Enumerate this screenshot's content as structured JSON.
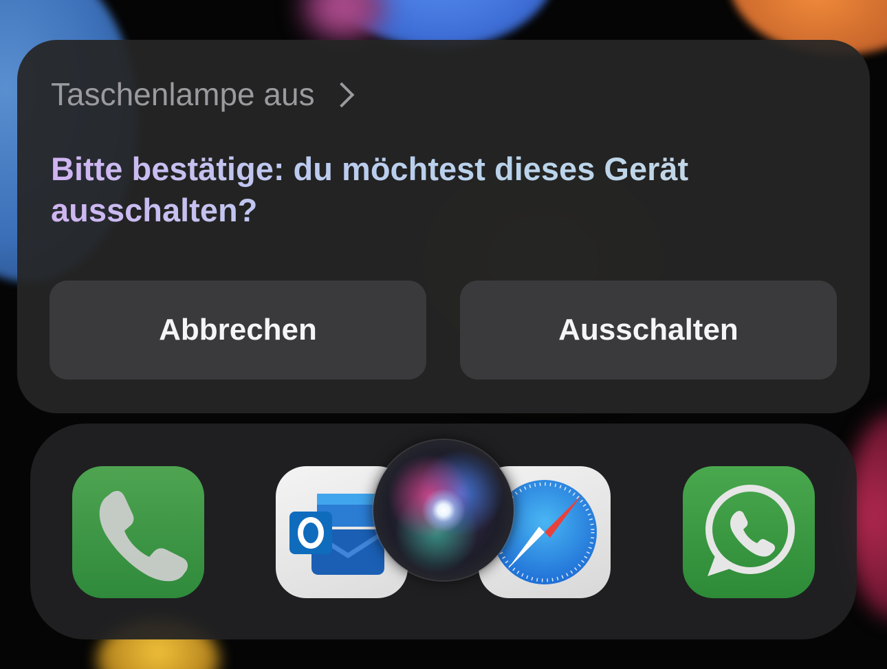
{
  "siri_card": {
    "header": "Taschenlampe aus",
    "prompt": "Bitte bestätige: du möchtest dieses Gerät ausschalten?",
    "buttons": {
      "cancel": "Abbrechen",
      "confirm": "Ausschalten"
    }
  },
  "dock": {
    "apps": [
      {
        "name": "Telefon",
        "icon": "phone-icon"
      },
      {
        "name": "Outlook",
        "icon": "outlook-icon"
      },
      {
        "name": "Safari",
        "icon": "safari-icon"
      },
      {
        "name": "WhatsApp",
        "icon": "whatsapp-icon"
      }
    ],
    "siri_indicator": "siri-orb-icon"
  },
  "colors": {
    "card_background": "#262626",
    "button_background": "#3a3a3c",
    "header_text": "#9a9a9f",
    "prompt_gradient_start": "#d0b4f2",
    "prompt_gradient_end": "#c8d9e6",
    "phone_green": "#3f9a46",
    "outlook_blue": "#0f6cbd",
    "whatsapp_green": "#3d9a44"
  }
}
